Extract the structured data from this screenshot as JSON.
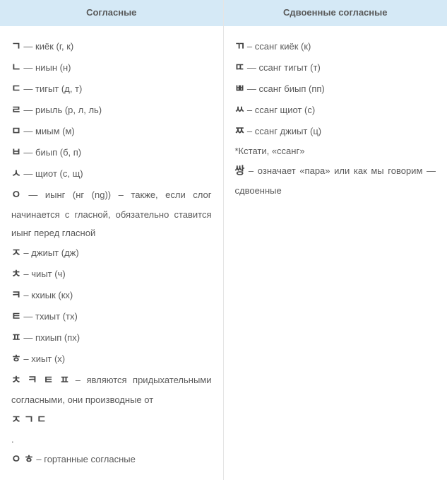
{
  "headers": {
    "left": "Согласные",
    "right": "Сдвоенные согласные"
  },
  "left": {
    "rows": [
      {
        "jamo": "ㄱ",
        "sep": "—",
        "text": "киёк (г, к)"
      },
      {
        "jamo": "ㄴ",
        "sep": "—",
        "text": "ниын (н)"
      },
      {
        "jamo": "ㄷ",
        "sep": "—",
        "text": "тигыт (д, т)"
      },
      {
        "jamo": "ㄹ",
        "sep": "—",
        "text": "риыль (р, л, ль)"
      },
      {
        "jamo": "ㅁ",
        "sep": "—",
        "text": "миым (м)"
      },
      {
        "jamo": "ㅂ",
        "sep": "—",
        "text": "биып (б, п)"
      },
      {
        "jamo": "ㅅ",
        "sep": "—",
        "text": "щиот (с, щ)"
      },
      {
        "jamo": "ㅇ",
        "sep": "—",
        "text": "иынг (нг (ng)) – также, если слог начинается с гласной, обязательно ставится иынг перед гласной"
      },
      {
        "jamo": "ㅈ",
        "sep": "–",
        "text": "джиыт (дж)"
      },
      {
        "jamo": "ㅊ",
        "sep": "–",
        "text": "чиыт (ч)"
      },
      {
        "jamo": "ㅋ",
        "sep": "–",
        "text": "кхиык (кх)"
      },
      {
        "jamo": "ㅌ",
        "sep": "—",
        "text": "тхиыт (тх)"
      },
      {
        "jamo": "ㅍ",
        "sep": "—",
        "text": "пхиып (пх)"
      },
      {
        "jamo": "ㅎ",
        "sep": "–",
        "text": "хиыт (х)"
      }
    ],
    "note1_jamo": "ㅊ ㅋ ㅌ ㅍ",
    "note1_text": " – являются придыхательными согласными, они производные от",
    "note1_base": "ㅈ ㄱ ㄷ",
    "dot": ".",
    "note2_jamo": "ㅇ ㅎ",
    "note2_text": " – гортанные согласные"
  },
  "right": {
    "rows": [
      {
        "jamo": "ㄲ",
        "sep": "–",
        "text": "ссанг киёк (к)"
      },
      {
        "jamo": "ㄸ",
        "sep": "—",
        "text": "ссанг тигыт (т)"
      },
      {
        "jamo": "ㅃ",
        "sep": "—",
        "text": "ссанг биып (пп)"
      },
      {
        "jamo": "ㅆ",
        "sep": "–",
        "text": "ссанг щиот (с)"
      },
      {
        "jamo": "ㅉ",
        "sep": "–",
        "text": "ссанг джиыт (ц)"
      }
    ],
    "aside": "*Кстати, «ссанг»",
    "ssang_jamo": "쌍",
    "ssang_text": " – означает «пара» или как мы говорим — сдвоенные"
  }
}
